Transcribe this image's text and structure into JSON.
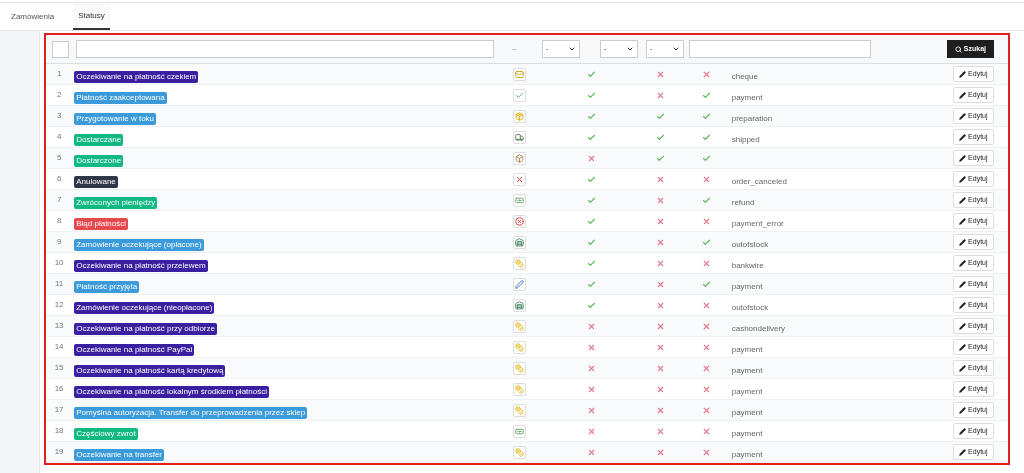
{
  "tabs": [
    {
      "label": "Zamówienia",
      "selected": false
    },
    {
      "label": "Statusy",
      "selected": true
    }
  ],
  "filters": {
    "icon_filter": "--",
    "selects": [
      "-",
      "-",
      "-"
    ],
    "search_button": "Szukaj"
  },
  "rows": [
    {
      "id": "1",
      "name": "Oczekiwanie na płatność czekiem",
      "color": "#3a1fa0",
      "kind": "envelope",
      "flags": [
        true,
        false,
        false
      ],
      "template": "cheque",
      "action": "Edytuj"
    },
    {
      "id": "2",
      "name": "Płatność zaakceptowana",
      "color": "#3b9ad9",
      "kind": "check",
      "flags": [
        true,
        false,
        true
      ],
      "template": "payment",
      "action": "Edytuj"
    },
    {
      "id": "3",
      "name": "Przygotowanie w toku",
      "color": "#3b9ad9",
      "kind": "package",
      "flags": [
        true,
        true,
        true
      ],
      "template": "preparation",
      "action": "Edytuj"
    },
    {
      "id": "4",
      "name": "Dostarczane",
      "color": "#10b981",
      "kind": "truck",
      "flags": [
        true,
        true,
        true
      ],
      "template": "shipped",
      "action": "Edytuj"
    },
    {
      "id": "5",
      "name": "Dostarczone",
      "color": "#10b981",
      "kind": "box",
      "flags": [
        false,
        true,
        true
      ],
      "action": "Edytuj"
    },
    {
      "id": "6",
      "name": "Anulowane",
      "color": "#2d3748",
      "kind": "cross",
      "flags": [
        true,
        false,
        false
      ],
      "template": "order_canceled",
      "action": "Edytuj"
    },
    {
      "id": "7",
      "name": "Zwróconych pieniędzy",
      "color": "#10b981",
      "kind": "banknote",
      "flags": [
        true,
        false,
        true
      ],
      "template": "refund",
      "action": "Edytuj"
    },
    {
      "id": "8",
      "name": "Błąd płatności",
      "color": "#e5484d",
      "kind": "error",
      "flags": [
        true,
        false,
        false
      ],
      "template": "payment_error",
      "action": "Edytuj"
    },
    {
      "id": "9",
      "name": "Zamówienie oczekujące (opłacone)",
      "color": "#3b9ad9",
      "kind": "stock",
      "flags": [
        true,
        false,
        true
      ],
      "template": "outofstock",
      "action": "Edytuj"
    },
    {
      "id": "10",
      "name": "Oczekiwanie na płatność przelewem",
      "color": "#3a1fa0",
      "kind": "coins",
      "flags": [
        true,
        false,
        false
      ],
      "template": "bankwire",
      "action": "Edytuj"
    },
    {
      "id": "11",
      "name": "Płatność przyjęta",
      "color": "#3b9ad9",
      "kind": "pen",
      "flags": [
        true,
        false,
        true
      ],
      "template": "payment",
      "action": "Edytuj"
    },
    {
      "id": "12",
      "name": "Zamówienie oczekujące (nieopłacone)",
      "color": "#3a1fa0",
      "kind": "stock",
      "flags": [
        true,
        false,
        false
      ],
      "template": "outofstock",
      "action": "Edytuj"
    },
    {
      "id": "13",
      "name": "Oczekiwanie na płatność przy odbiorze",
      "color": "#3a1fa0",
      "kind": "coins",
      "flags": [
        false,
        false,
        false
      ],
      "template": "cashondelivery",
      "action": "Edytuj"
    },
    {
      "id": "14",
      "name": "Oczekiwanie na płatność PayPal",
      "color": "#3a1fa0",
      "kind": "coins",
      "flags": [
        false,
        false,
        false
      ],
      "template": "payment",
      "action": "Edytuj"
    },
    {
      "id": "15",
      "name": "Oczekiwanie na płatność kartą kredytową",
      "color": "#3a1fa0",
      "kind": "coins",
      "flags": [
        false,
        false,
        false
      ],
      "template": "payment",
      "action": "Edytuj"
    },
    {
      "id": "16",
      "name": "Oczekiwanie na płatność lokalnym środkiem płatności",
      "color": "#3a1fa0",
      "kind": "coins",
      "flags": [
        false,
        false,
        false
      ],
      "template": "payment",
      "action": "Edytuj"
    },
    {
      "id": "17",
      "name": "Pomyślna autoryzacja. Transfer do przeprowadzenia przez sklep",
      "color": "#3b9ad9",
      "kind": "coins",
      "flags": [
        false,
        false,
        false
      ],
      "template": "payment",
      "action": "Edytuj"
    },
    {
      "id": "18",
      "name": "Częściowy zwrot",
      "color": "#10b981",
      "kind": "banknote",
      "flags": [
        false,
        false,
        false
      ],
      "template": "payment",
      "action": "Edytuj"
    },
    {
      "id": "19",
      "name": "Oczekiwanie na transfer",
      "color": "#3b9ad9",
      "kind": "coins",
      "flags": [
        false,
        false,
        false
      ],
      "template": "payment",
      "action": "Edytuj"
    }
  ]
}
